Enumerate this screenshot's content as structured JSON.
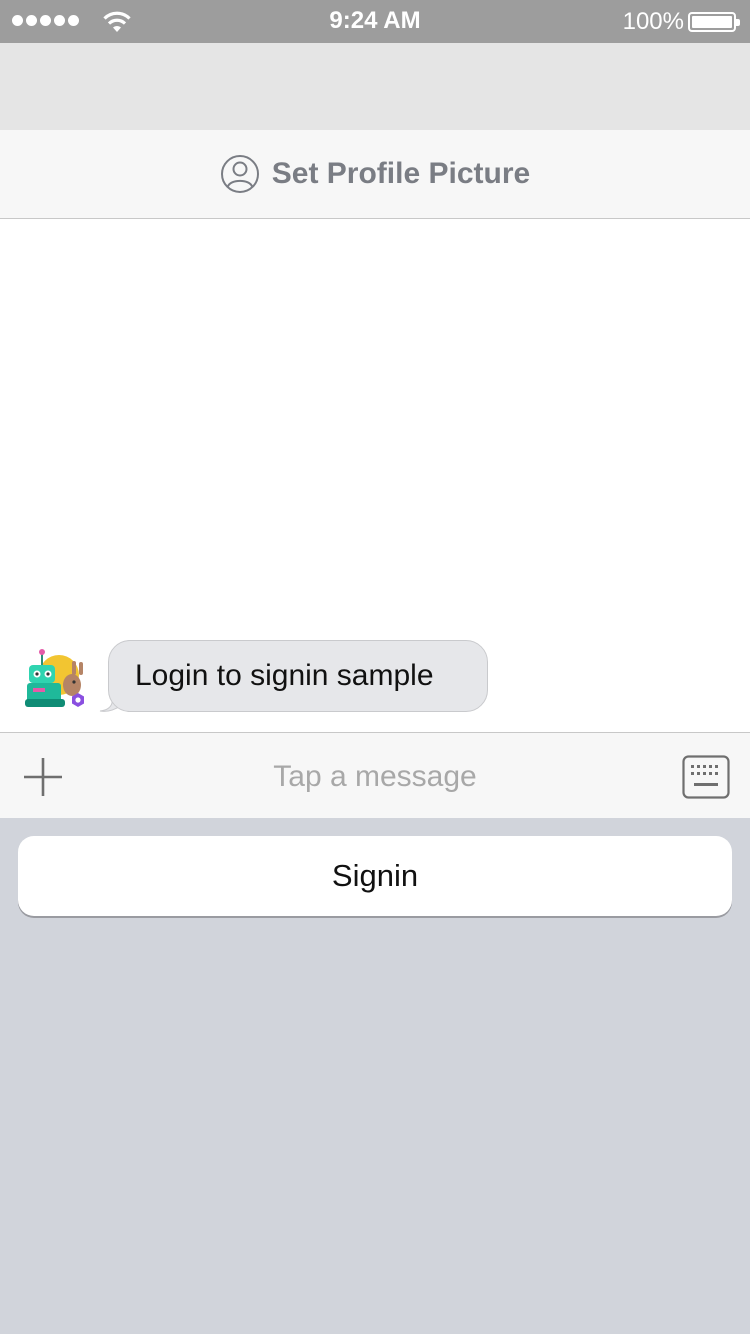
{
  "status_bar": {
    "time": "9:24 AM",
    "battery_percent": "100%",
    "signal_bars": 5,
    "battery_level": 1.0
  },
  "profile": {
    "label": "Set Profile Picture",
    "icon": "person-circle-icon"
  },
  "chat": {
    "messages": [
      {
        "sender": "bot",
        "avatar": "bot-robot-avatar",
        "text": "Login to signin sample"
      }
    ]
  },
  "composer": {
    "placeholder": "Tap a message",
    "value": "",
    "left_icon": "plus-icon",
    "right_icon": "keyboard-icon"
  },
  "quick_replies": [
    {
      "label": "Signin"
    }
  ],
  "colors": {
    "status_bar_bg": "#9d9d9d",
    "nav_bg": "#e5e5e5",
    "profile_bar_bg": "#f7f7f7",
    "bubble_bg": "#e6e7ea",
    "keyboard_area_bg": "#d1d4db",
    "profile_text": "#7a7d84"
  }
}
